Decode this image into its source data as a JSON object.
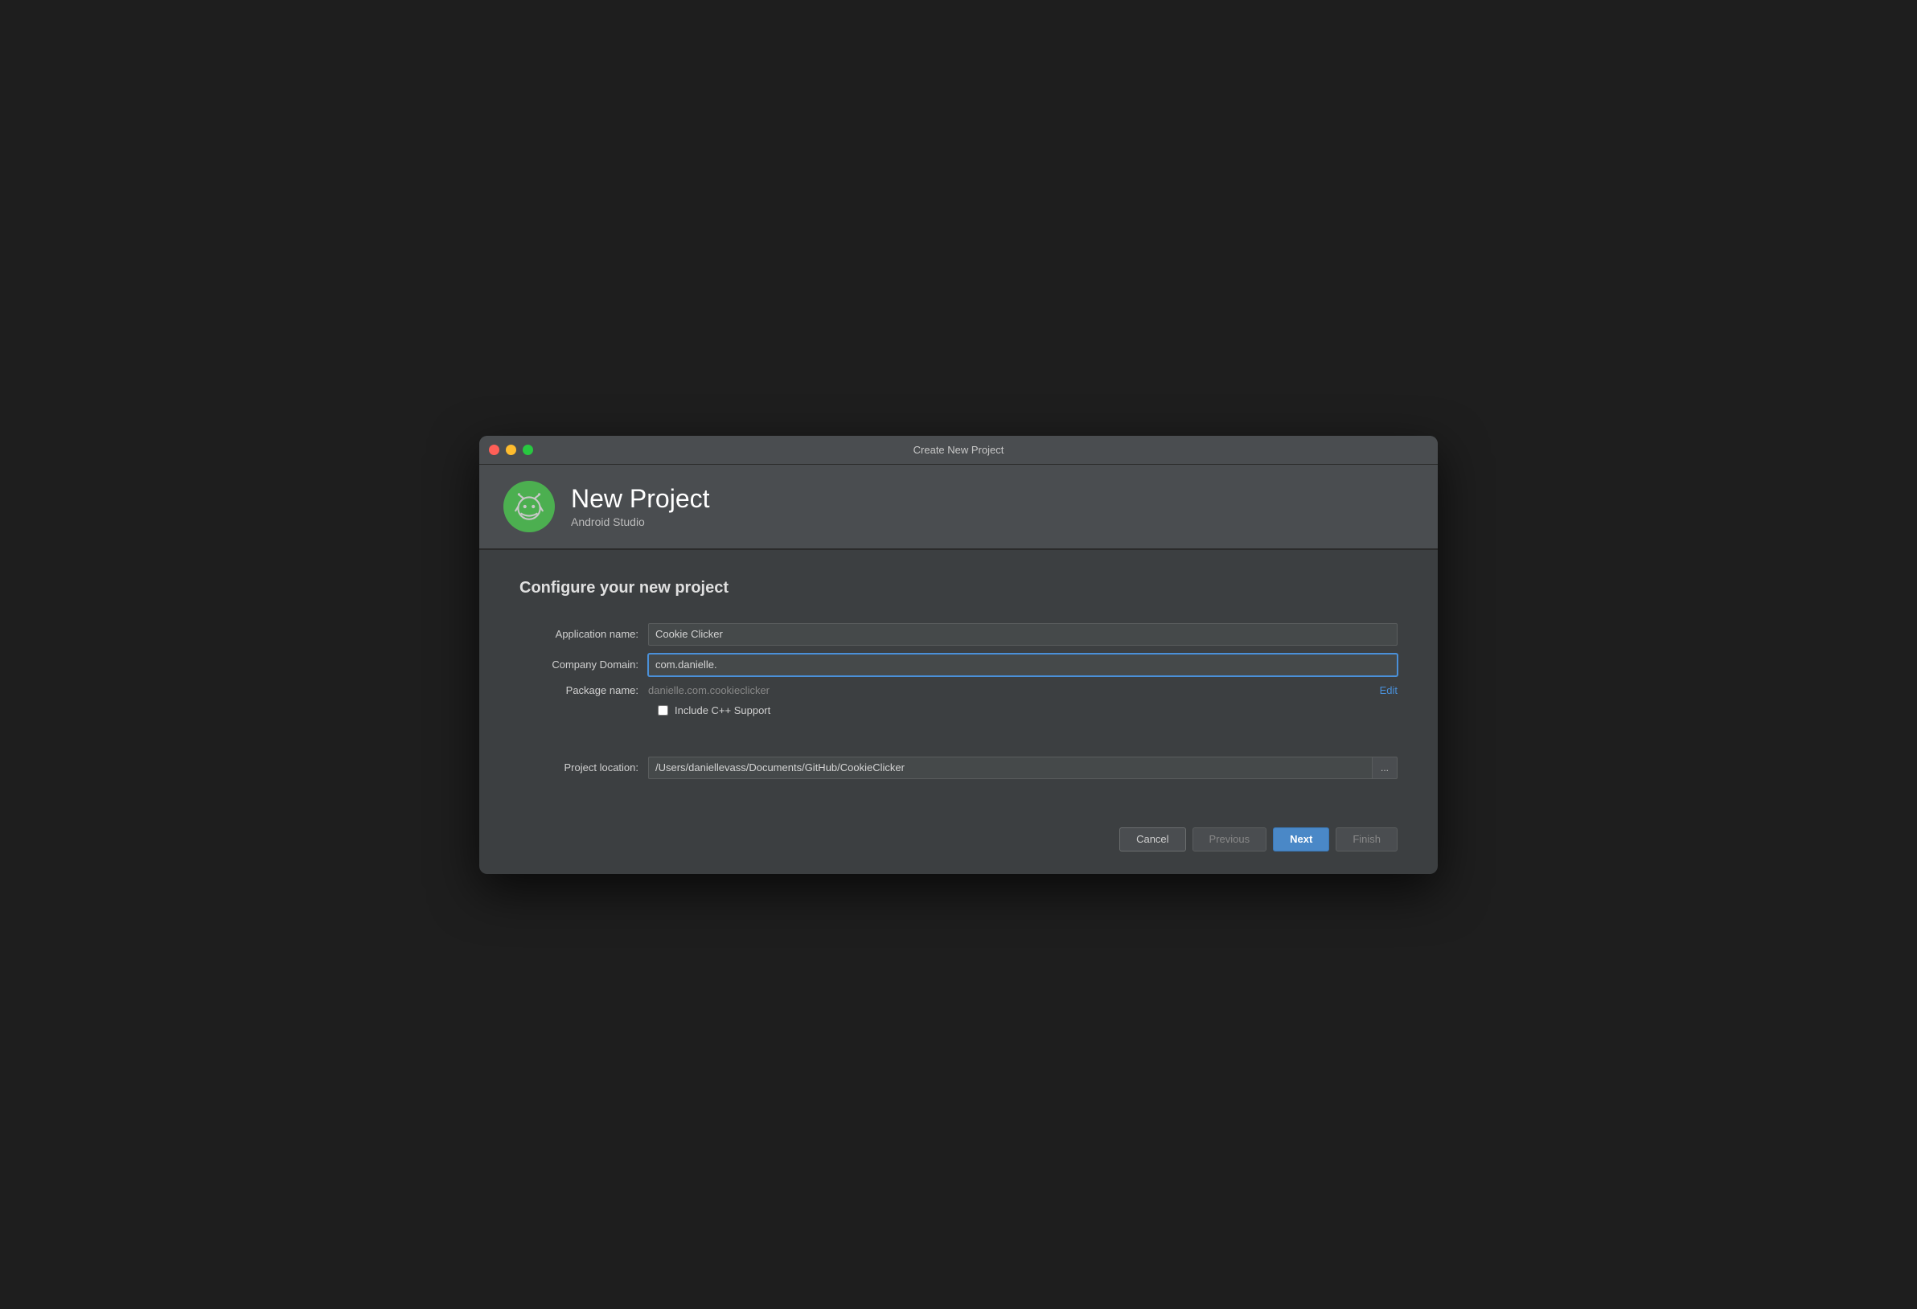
{
  "window": {
    "title": "Create New Project"
  },
  "controls": {
    "close": "close",
    "minimize": "minimize",
    "maximize": "maximize"
  },
  "header": {
    "project_title": "New Project",
    "project_subtitle": "Android Studio",
    "logo_alt": "Android Studio Logo"
  },
  "main": {
    "configure_title": "Configure your new project",
    "fields": {
      "app_name_label": "Application name:",
      "app_name_value": "Cookie Clicker",
      "company_domain_label": "Company Domain:",
      "company_domain_value": "com.danielle.",
      "package_name_label": "Package name:",
      "package_name_value": "danielle.com.cookieclicker",
      "edit_label": "Edit",
      "cpp_support_label": "Include C++ Support"
    },
    "location": {
      "label": "Project location:",
      "value": "/Users/daniellevass/Documents/GitHub/CookieClicker",
      "browse_label": "..."
    }
  },
  "footer": {
    "cancel_label": "Cancel",
    "previous_label": "Previous",
    "next_label": "Next",
    "finish_label": "Finish"
  }
}
